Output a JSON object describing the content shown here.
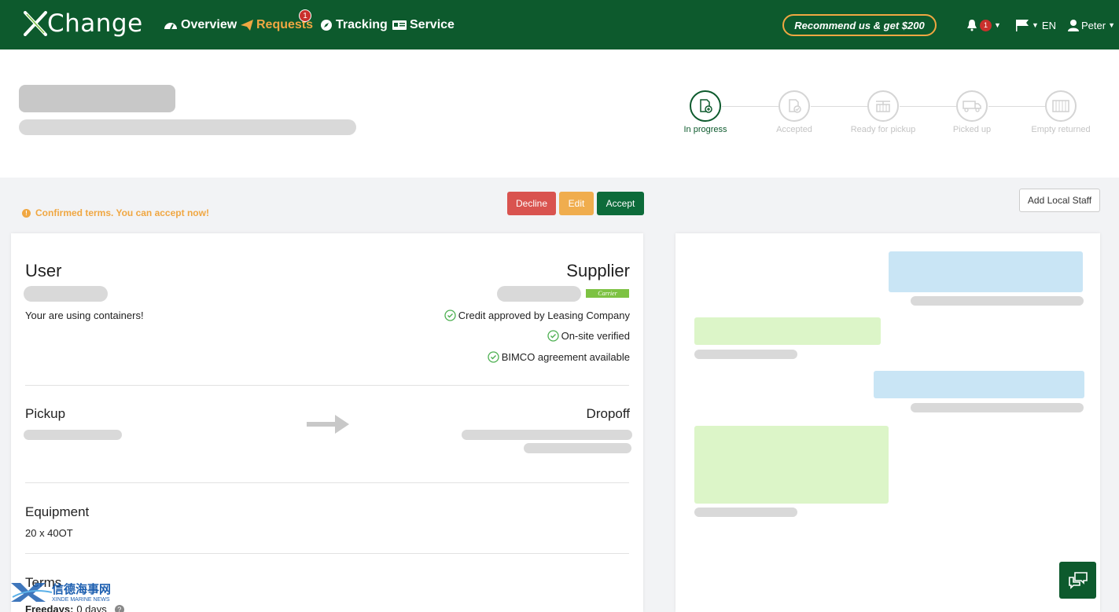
{
  "brand": {
    "name": "Change"
  },
  "nav": {
    "overview": "Overview",
    "requests": "Requests",
    "requests_badge": "1",
    "tracking": "Tracking",
    "service": "Service"
  },
  "recommend": "Recommend us & get $200",
  "topright": {
    "notif_count": "1",
    "language": "EN",
    "user": "Peter"
  },
  "steps": [
    {
      "label": "In progress",
      "active": true
    },
    {
      "label": "Accepted",
      "active": false
    },
    {
      "label": "Ready for pickup",
      "active": false
    },
    {
      "label": "Picked up",
      "active": false
    },
    {
      "label": "Empty returned",
      "active": false
    }
  ],
  "notice": "Confirmed terms. You can accept now!",
  "actions": {
    "decline": "Decline",
    "edit": "Edit",
    "accept": "Accept",
    "add_staff": "Add Local Staff"
  },
  "user_section": {
    "title": "User",
    "note": "Your are using containers!"
  },
  "supplier_section": {
    "title": "Supplier",
    "tag": "Carrier",
    "verifications": [
      "Credit approved by Leasing Company",
      "On-site verified",
      "BIMCO agreement available"
    ]
  },
  "pickup": {
    "title": "Pickup"
  },
  "dropoff": {
    "title": "Dropoff"
  },
  "equipment": {
    "title": "Equipment",
    "value": "20 x 40OT"
  },
  "terms": {
    "title": "Terms",
    "freedays_label": "Freedays:",
    "freedays_value": "0 days"
  },
  "watermark": {
    "cn": "信德海事网",
    "en": "XINDE MARINE NEWS"
  },
  "colors": {
    "brand_green": "#0d5a2d",
    "accent_orange": "#f0a742",
    "decline_red": "#d9534f"
  }
}
